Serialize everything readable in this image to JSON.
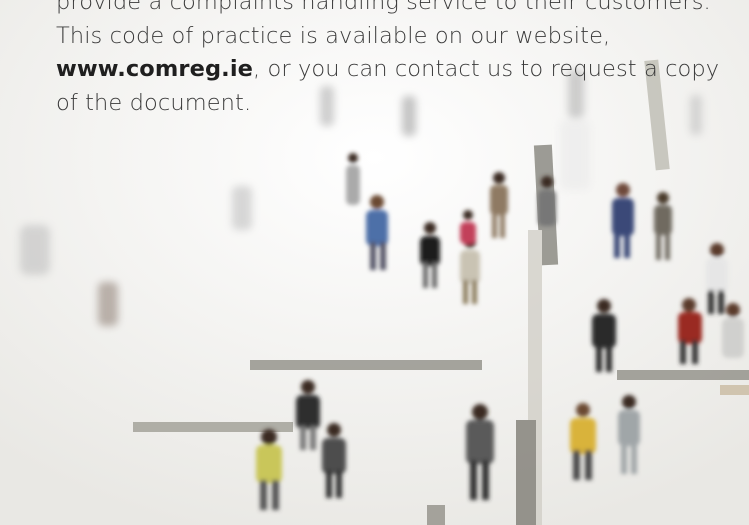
{
  "document": {
    "lines": [
      "provide a complaints handling service to their customers.",
      "This code of practice is available on our website,"
    ],
    "link_text": "www.comreg.ie",
    "line3_rest": ", or you can contact us to request a copy",
    "line4": "of the document."
  },
  "image": {
    "subject": "crowd-photo",
    "colors": {
      "floor": "#f4f4f2",
      "stripe": "#8c8a82",
      "text": "#3a3a3a"
    }
  }
}
